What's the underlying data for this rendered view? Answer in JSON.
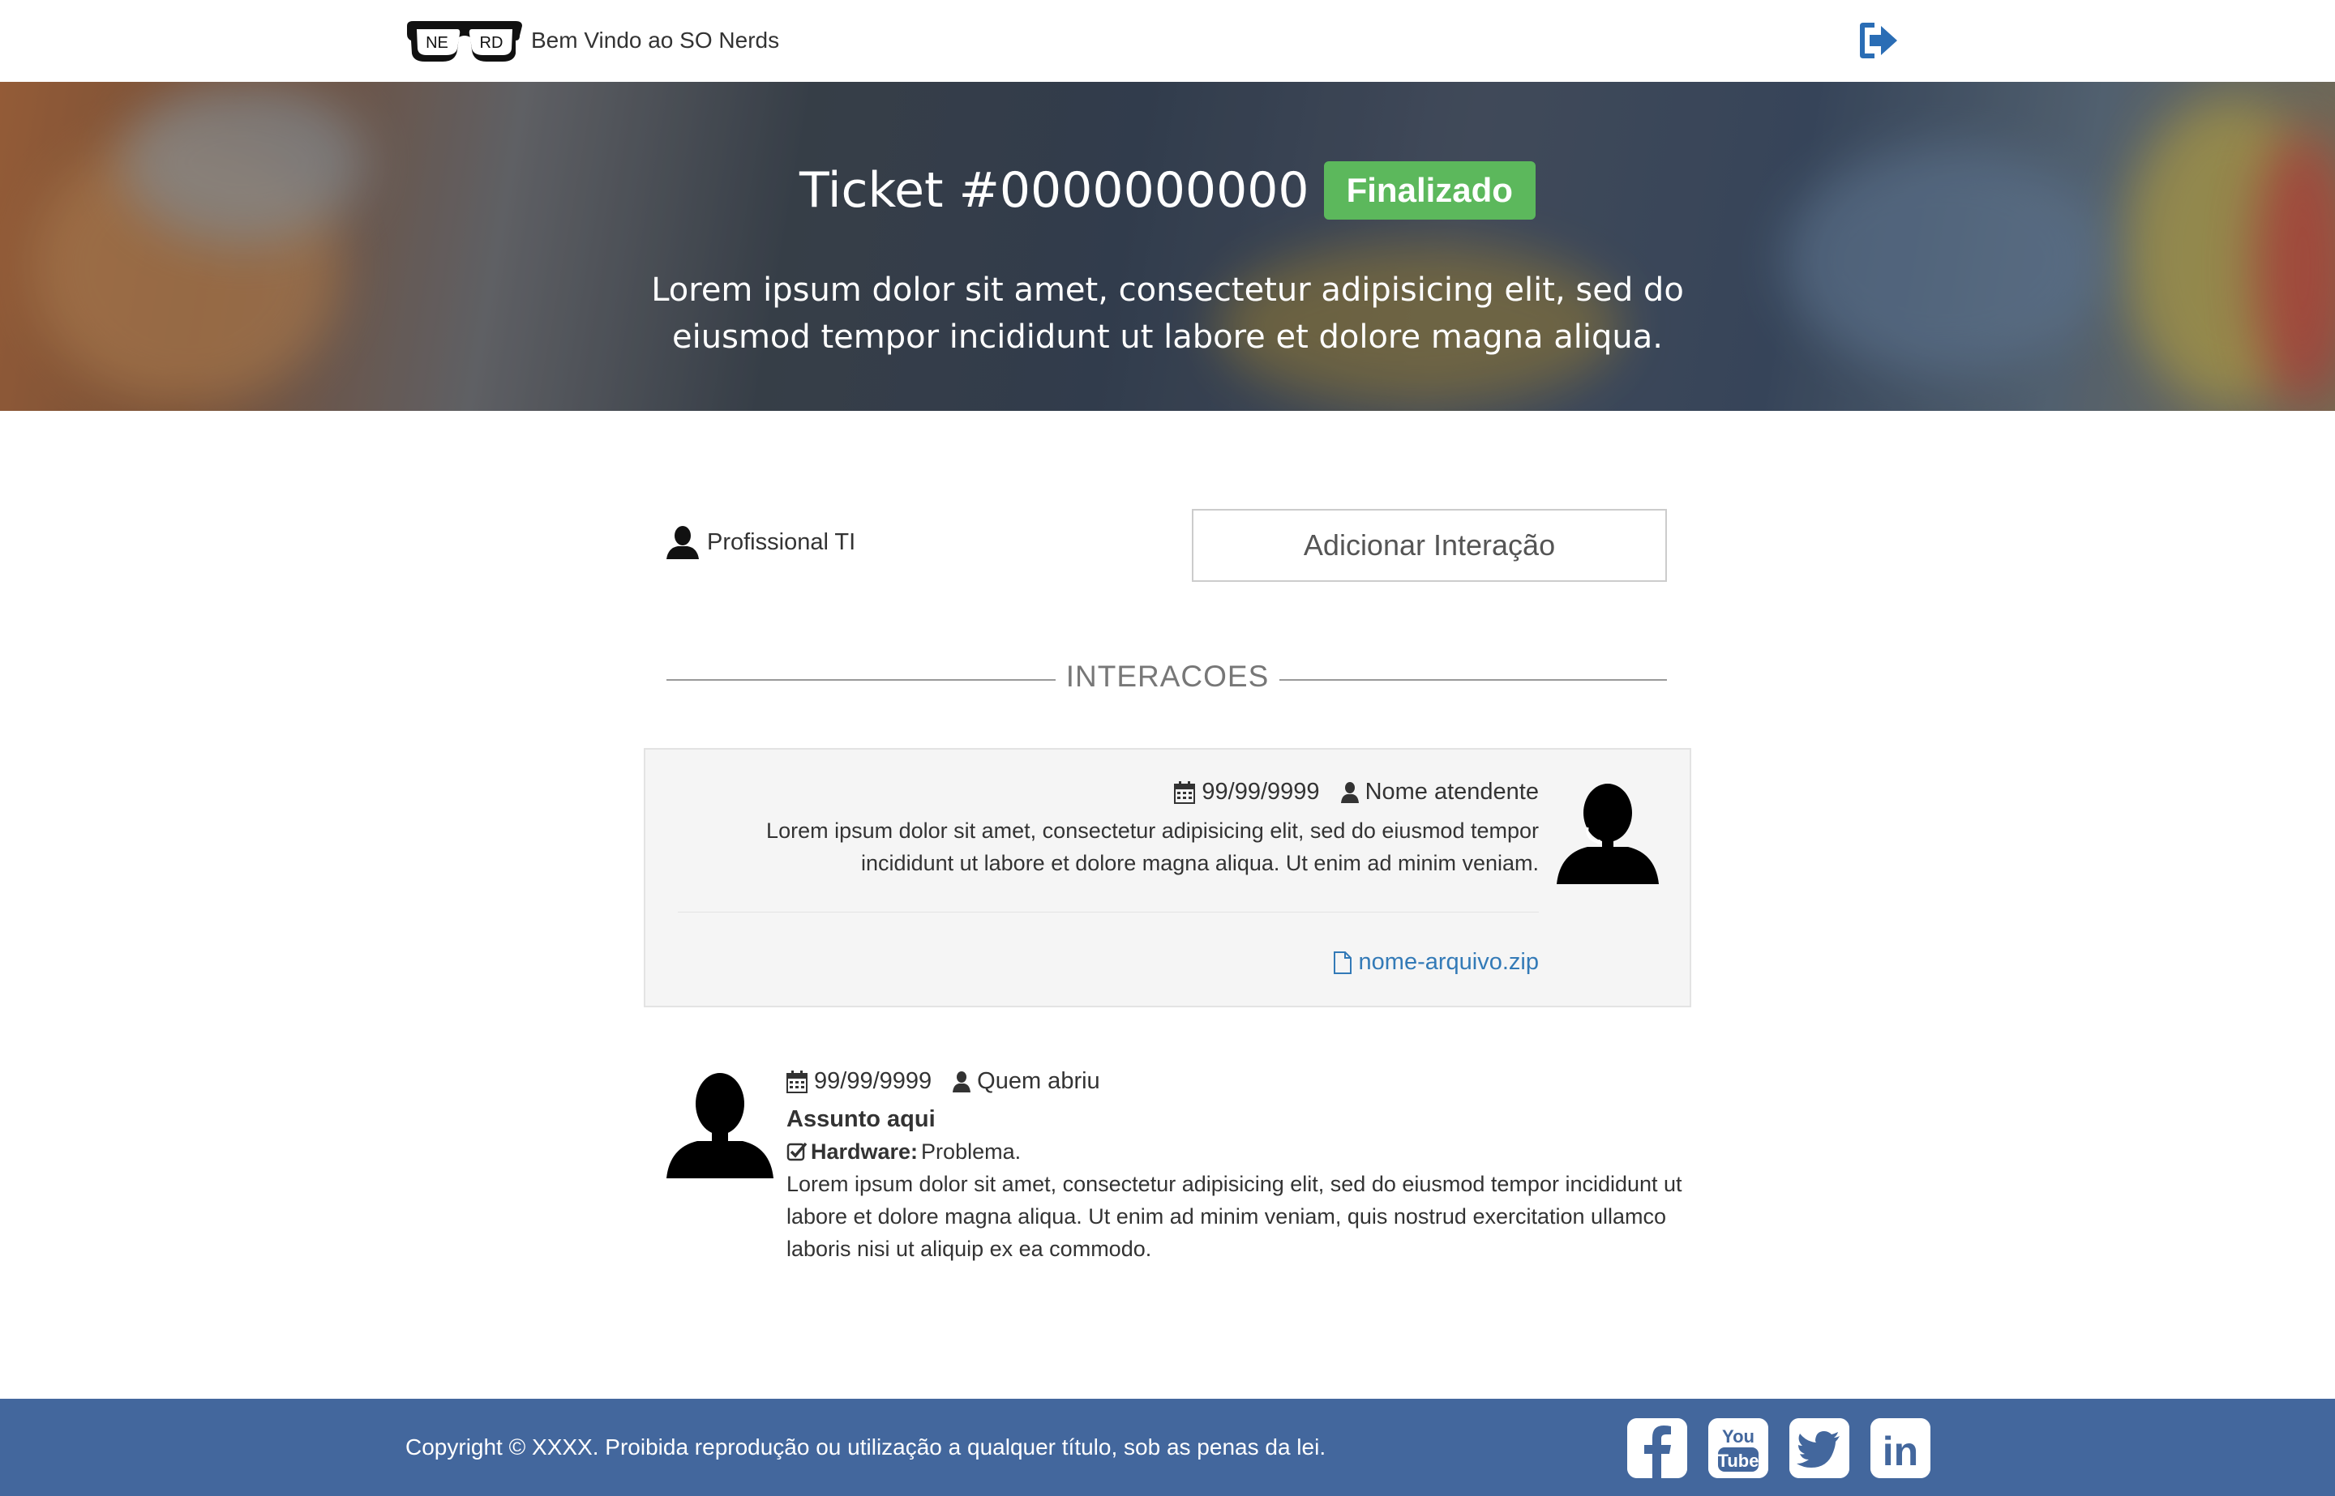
{
  "navbar": {
    "brand_text": "Bem Vindo ao SO Nerds",
    "logo_left": "NE",
    "logo_right": "RD",
    "logout_icon": "sign-out-icon"
  },
  "hero": {
    "ticket_title": "Ticket #0000000000",
    "status": "Finalizado",
    "status_color": "#5cb85c",
    "description": "Lorem ipsum dolor sit amet, consectetur adipisicing elit, sed do eiusmod tempor incididunt ut labore et dolore magna aliqua."
  },
  "assignee": {
    "icon": "user-icon",
    "label": "Profissional TI"
  },
  "actions": {
    "add_interaction": "Adicionar Interação"
  },
  "section": {
    "title": "INTERACOES"
  },
  "interaction": {
    "date": "99/99/9999",
    "author": "Nome atendente",
    "message": "Lorem ipsum dolor sit amet, consectetur adipisicing elit, sed do eiusmod tempor incididunt ut labore et dolore magna aliqua. Ut enim ad minim veniam.",
    "attachment": "nome-arquivo.zip",
    "avatar_icon": "support-agent-icon"
  },
  "ticket_entry": {
    "date": "99/99/9999",
    "author": "Quem abriu",
    "subject": "Assunto aqui",
    "category_label": "Hardware:",
    "category_value": "Problema.",
    "body": "Lorem ipsum dolor sit amet, consectetur adipisicing elit, sed do eiusmod tempor incididunt ut labore et dolore magna aliqua. Ut enim ad minim veniam, quis nostrud exercitation ullamco laboris nisi ut aliquip ex ea commodo.",
    "avatar_icon": "user-avatar-icon"
  },
  "footer": {
    "copyright": "Copyright © XXXX. Proibida reprodução ou utilização a qualquer título, sob as penas da lei.",
    "background": "#43679d",
    "social": [
      {
        "icon": "facebook-icon"
      },
      {
        "icon": "youtube-icon",
        "text_top": "You",
        "text_bottom": "Tube"
      },
      {
        "icon": "twitter-icon"
      },
      {
        "icon": "linkedin-icon",
        "text": "in"
      }
    ]
  },
  "colors": {
    "link": "#337ab7",
    "accent": "#2a6db5"
  }
}
